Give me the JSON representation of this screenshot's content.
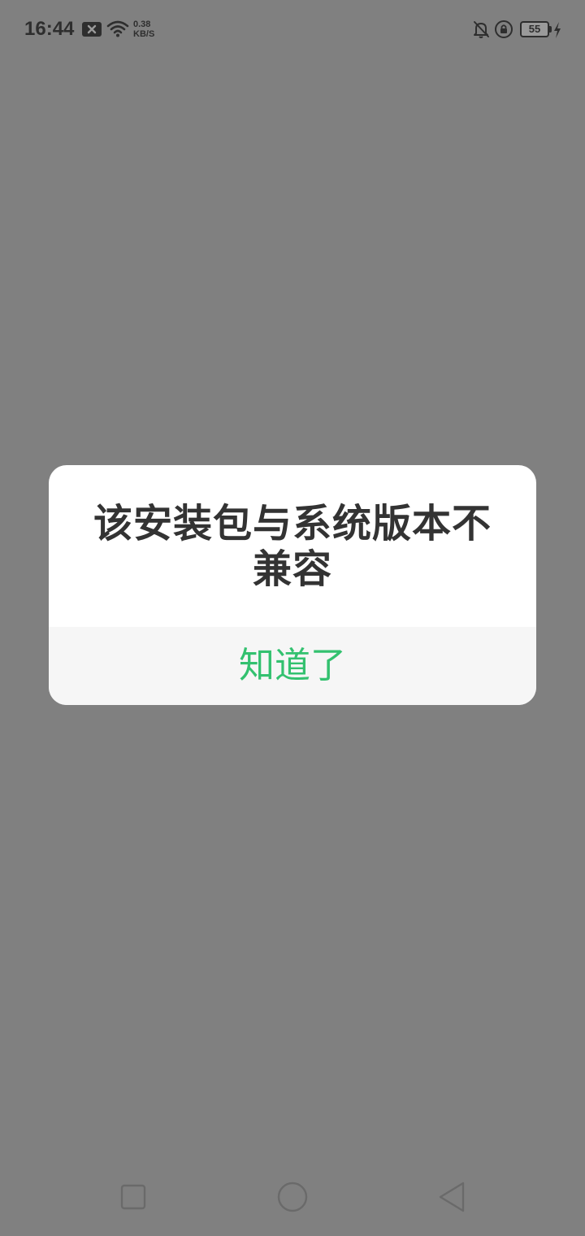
{
  "status_bar": {
    "time": "16:44",
    "net_speed_value": "0.38",
    "net_speed_unit": "KB/S",
    "battery_level": "55",
    "icons": [
      "notification-x-icon",
      "wifi-icon",
      "bell-off-icon",
      "rotation-lock-icon",
      "battery-icon",
      "charging-bolt-icon"
    ]
  },
  "dialog": {
    "message": "该安装包与系统版本不兼容",
    "button_label": "知道了"
  },
  "nav_bar": {
    "icons": [
      "recent-apps-icon",
      "home-icon",
      "back-icon"
    ]
  },
  "colors": {
    "overlay": "#808080",
    "dialog_bg": "#ffffff",
    "footer_bg": "#f6f6f6",
    "accent": "#33c16f",
    "text": "#333333"
  }
}
